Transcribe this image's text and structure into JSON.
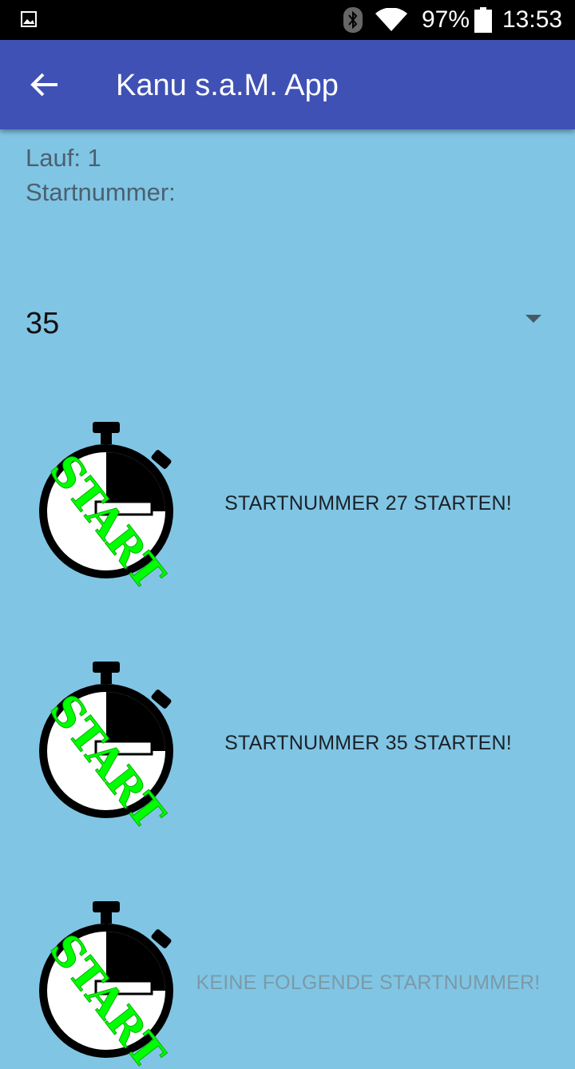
{
  "status_bar": {
    "battery_percent": "97%",
    "time": "13:53"
  },
  "app_bar": {
    "title": "Kanu s.a.M. App"
  },
  "info": {
    "lauf": "Lauf: 1",
    "startnummer_label": "Startnummer:"
  },
  "spinner": {
    "selected": "35"
  },
  "start_buttons": [
    {
      "label": "STARTNUMMER 27 STARTEN!",
      "enabled": true
    },
    {
      "label": "STARTNUMMER 35 STARTEN!",
      "enabled": true
    },
    {
      "label": "KEINE FOLGENDE STARTNUMMER!",
      "enabled": false
    }
  ],
  "colors": {
    "background": "#81c5e4",
    "app_bar": "#3f51b5",
    "start_text": "#00ff00"
  }
}
